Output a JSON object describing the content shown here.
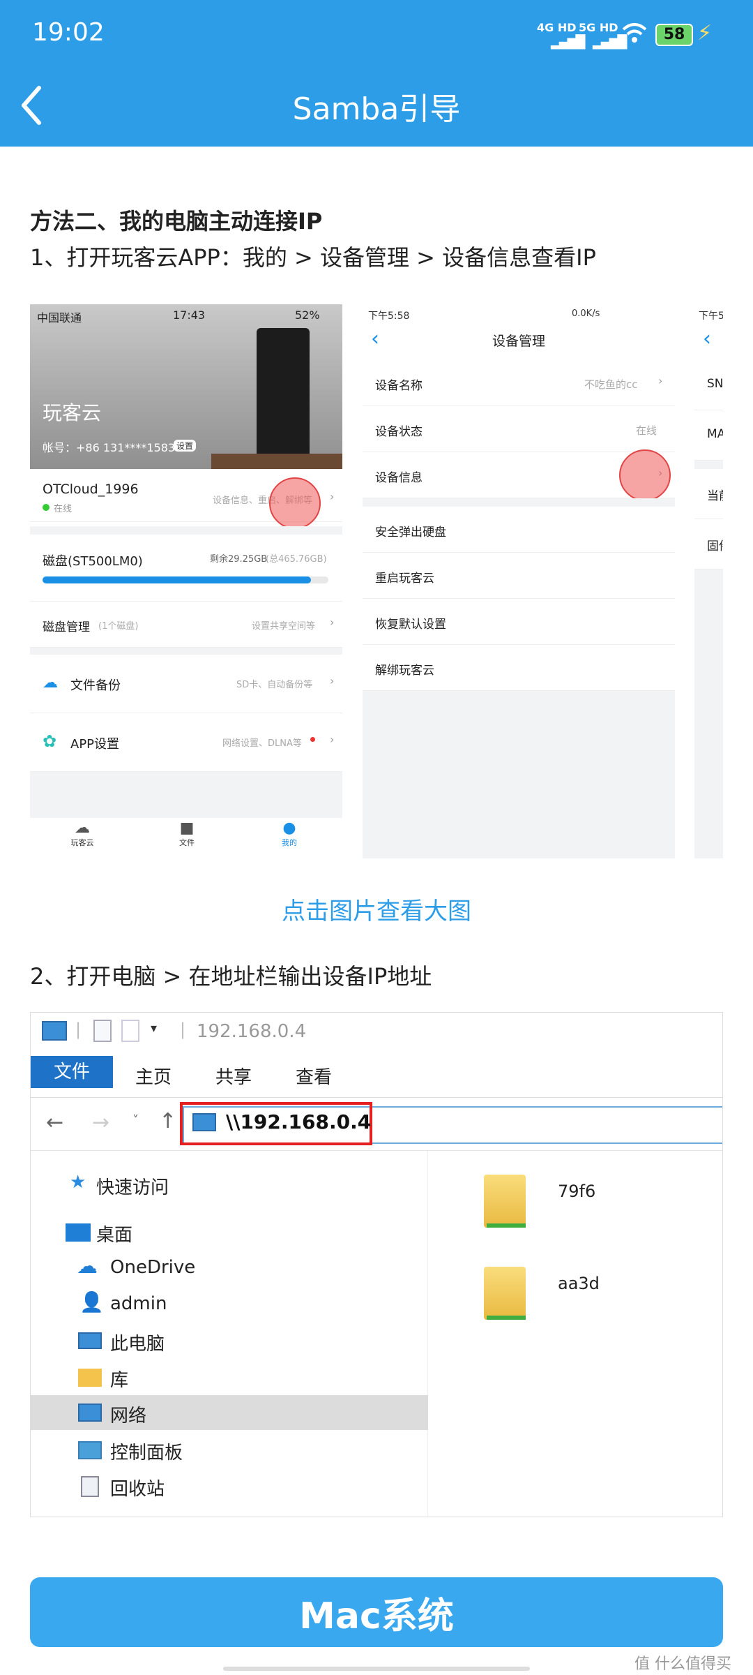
{
  "status_bar": {
    "time": "19:02",
    "net1": "4G HD",
    "net2": "5G HD",
    "battery": "58"
  },
  "nav": {
    "title": "Samba引导"
  },
  "content": {
    "heading": "方法二、我的电脑主动连接IP",
    "step1": "1、打开玩客云APP：我的 > 设备管理 > 设备信息查看IP",
    "click_hint": "点击图片查看大图",
    "step2": "2、打开电脑 > 在地址栏输出设备IP地址"
  },
  "shot1": {
    "carrier": "中国联通",
    "time": "17:43",
    "battery": "52%",
    "brand": "玩客云",
    "account": "帐号：+86 131****1583",
    "account_tag": "设置",
    "device_name": "OTCloud_1996",
    "device_status": "在线",
    "device_actions": "设备信息、重启、解绑等",
    "disk_name": "磁盘(ST500LM0)",
    "disk_free": "剩余29.25GB",
    "disk_total": "(总465.76GB)",
    "disk_fill": 0.94,
    "disk_mgmt": "磁盘管理",
    "disk_count": "(1个磁盘)",
    "disk_mgmt_hint": "设置共享空间等",
    "backup": "文件备份",
    "backup_hint": "SD卡、自动备份等",
    "app_settings": "APP设置",
    "app_settings_hint": "网络设置、DLNA等",
    "tabs": [
      "玩客云",
      "文件",
      "我的"
    ]
  },
  "shot2": {
    "time": "下午5:58",
    "speed": "0.0K/s",
    "title": "设备管理",
    "rows": [
      {
        "label": "设备名称",
        "value": "不吃鱼的cc"
      },
      {
        "label": "设备状态",
        "value": "在线"
      },
      {
        "label": "设备信息",
        "value": ""
      }
    ],
    "actions": [
      "安全弹出硬盘",
      "重启玩客云",
      "恢复默认设置",
      "解绑玩客云"
    ]
  },
  "shot3": {
    "time": "下午5",
    "items": [
      "SN",
      "MA",
      "当前",
      "固件"
    ]
  },
  "explorer": {
    "title": "192.168.0.4",
    "tabs": [
      "文件",
      "主页",
      "共享",
      "查看"
    ],
    "address": "\\\\192.168.0.4",
    "nav": [
      "快速访问",
      "桌面",
      "OneDrive",
      "admin",
      "此电脑",
      "库",
      "网络",
      "控制面板",
      "回收站"
    ],
    "folders": [
      "79f6",
      "aa3d"
    ]
  },
  "button": {
    "label": "Mac系统"
  },
  "watermark": "什么值得买",
  "colors": {
    "primary": "#2d9de8",
    "button": "#3aa8ee",
    "link": "#2d9de8",
    "highlight_red": "#e52020"
  }
}
